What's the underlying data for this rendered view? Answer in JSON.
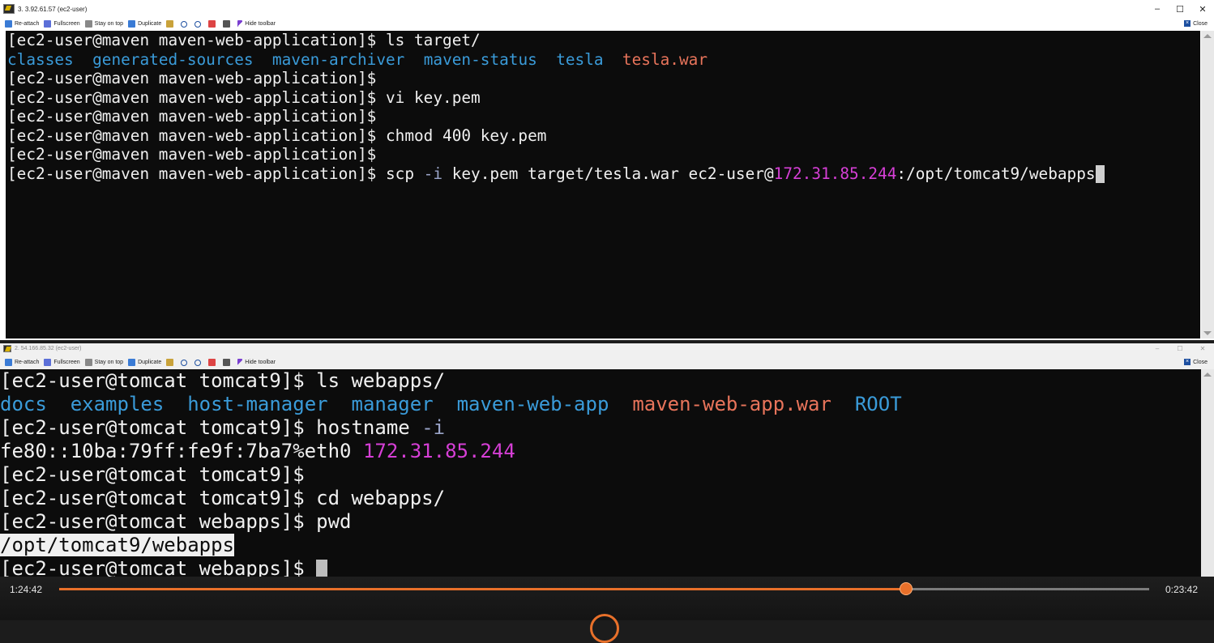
{
  "colors": {
    "terminal_bg": "#0c0c0c",
    "text": "#f0f0f0",
    "dir_blue": "#3a9bd9",
    "archive_red": "#e8745b",
    "ip_magenta": "#d63fd6",
    "progress_orange": "#e8702a"
  },
  "top_window": {
    "title": "3. 3.92.61.57 (ec2-user)",
    "controls": {
      "minimize": "–",
      "maximize": "☐",
      "close": "✕"
    },
    "toolbar": {
      "reattach": "Re-attach",
      "fullscreen": "Fullscreen",
      "stay_on_top": "Stay on top",
      "duplicate": "Duplicate",
      "hide_toolbar": "Hide toolbar",
      "close": "Close"
    },
    "terminal": {
      "prompt": "[ec2-user@maven maven-web-application]$",
      "cmd1": " ls target/",
      "ls_out": {
        "classes": "classes",
        "generated_sources": "generated-sources",
        "maven_archiver": "maven-archiver",
        "maven_status": "maven-status",
        "tesla": "tesla",
        "tesla_war": "tesla.war"
      },
      "cmd_vi": " vi key.pem",
      "cmd_chmod": " chmod 400 key.pem",
      "scp": {
        "part1": " scp ",
        "opt": "-i",
        "part2": " key.pem target/tesla.war ec2-user@",
        "ip": "172.31.85.244",
        "part3": ":/opt/tomcat9/webapps"
      }
    }
  },
  "bottom_window": {
    "title": "2. 54.166.85.32 (ec2-user)",
    "controls": {
      "minimize": "–",
      "maximize": "☐",
      "close": "✕"
    },
    "toolbar": {
      "reattach": "Re-attach",
      "fullscreen": "Fullscreen",
      "stay_on_top": "Stay on top",
      "duplicate": "Duplicate",
      "hide_toolbar": "Hide toolbar",
      "close": "Close"
    },
    "terminal": {
      "prompt_tomcat9": "[ec2-user@tomcat tomcat9]$",
      "prompt_webapps": "[ec2-user@tomcat webapps]$",
      "cmd_ls": " ls webapps/",
      "ls_out": {
        "docs": "docs",
        "examples": "examples",
        "host_manager": "host-manager",
        "manager": "manager",
        "maven_web_app": "maven-web-app",
        "maven_web_app_war": "maven-web-app.war",
        "root": "ROOT"
      },
      "cmd_hostname": " hostname ",
      "hostname_opt": "-i",
      "ipv6": "fe80::10ba:79ff:fe9f:7ba7%eth0 ",
      "ipv4": "172.31.85.244",
      "cmd_cd": " cd webapps/",
      "cmd_pwd": " pwd",
      "pwd_out": "/opt/tomcat9/webapps",
      "last_prompt_tail": " "
    }
  },
  "player": {
    "elapsed": "1:24:42",
    "remaining": "0:23:42",
    "progress_fraction": 0.777
  }
}
